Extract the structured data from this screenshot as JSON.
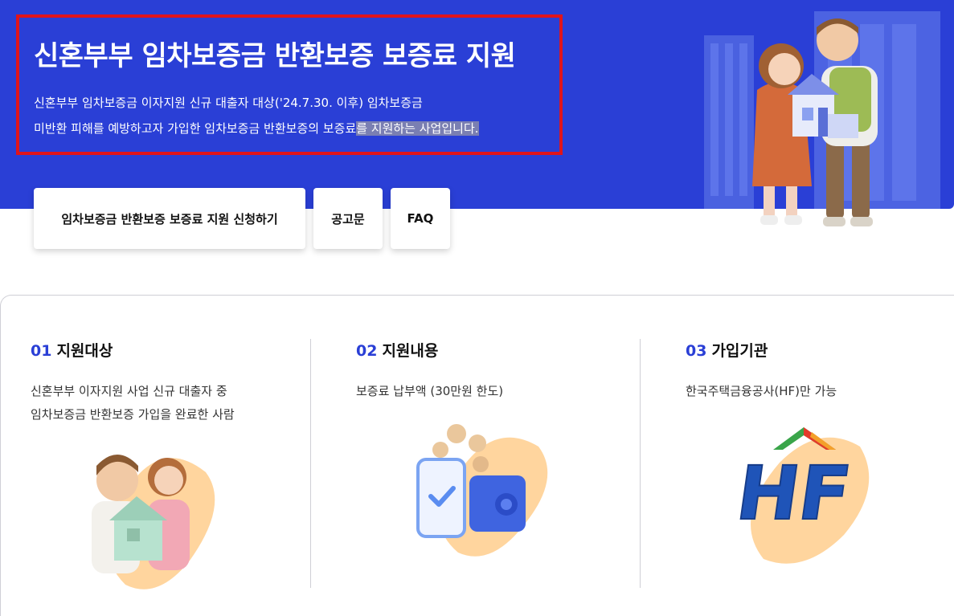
{
  "hero": {
    "title": "신혼부부 임차보증금 반환보증 보증료 지원",
    "desc_line1": "신혼부부 임차보증금 이자지원 신규 대출자 대상('24.7.30. 이후) 임차보증금",
    "desc_line2_a": "미반환 피해를 예방하고자 가입한 임차보증금 반환보증의 보증료",
    "desc_line2_b": "를 지원하는 사업입니다."
  },
  "buttons": {
    "apply": "임차보증금 반환보증 보증료 지원 신청하기",
    "notice": "공고문",
    "faq": "FAQ"
  },
  "sections": [
    {
      "num": "01",
      "title": "지원대상",
      "desc": [
        "신혼부부 이자지원 사업 신규 대출자 중",
        "임차보증금 반환보증 가입을 완료한 사람"
      ]
    },
    {
      "num": "02",
      "title": "지원내용",
      "desc": [
        "보증료 납부액 (30만원 한도)"
      ]
    },
    {
      "num": "03",
      "title": "가입기관",
      "desc": [
        "한국주택금융공사(HF)만 가능"
      ]
    }
  ],
  "logo_text": "HF",
  "colors": {
    "hero_bg": "#2a3fd6",
    "highlight_box": "#e0141b",
    "accent": "#2a3fd6",
    "blob": "#ffd59e"
  }
}
